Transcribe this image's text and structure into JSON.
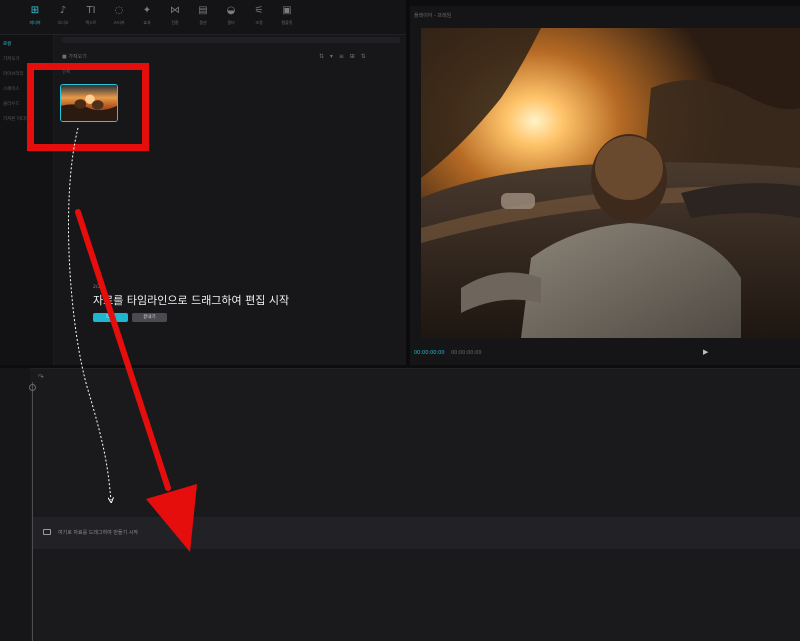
{
  "toolbar": {
    "tools": [
      {
        "icon": "media-icon",
        "glyph": "⊞",
        "label": "미디어",
        "active": true
      },
      {
        "icon": "audio-icon",
        "glyph": "♪",
        "label": "오디오",
        "active": false
      },
      {
        "icon": "text-icon",
        "glyph": "TI",
        "label": "텍스트",
        "active": false
      },
      {
        "icon": "sticker-icon",
        "glyph": "◌",
        "label": "스티커",
        "active": false
      },
      {
        "icon": "effects-icon",
        "glyph": "✦",
        "label": "효과",
        "active": false
      },
      {
        "icon": "transition-icon",
        "glyph": "⋈",
        "label": "전환",
        "active": false
      },
      {
        "icon": "caption-icon",
        "glyph": "▤",
        "label": "캡션",
        "active": false
      },
      {
        "icon": "filter-icon",
        "glyph": "◒",
        "label": "필터",
        "active": false
      },
      {
        "icon": "adjust-icon",
        "glyph": "⚟",
        "label": "조정",
        "active": false
      },
      {
        "icon": "template-icon",
        "glyph": "▣",
        "label": "템플릿",
        "active": false
      }
    ]
  },
  "leftnav": {
    "items": [
      {
        "label": "로컬",
        "active": true
      },
      {
        "label": "가져오기",
        "active": false
      },
      {
        "label": "라이브러리",
        "active": false
      },
      {
        "label": "스페이스",
        "active": false
      },
      {
        "label": "클라우드",
        "active": false
      },
      {
        "label": "가져온 미디어",
        "active": false
      }
    ]
  },
  "media": {
    "header": "■ 가져오기",
    "tools": "⇅ ▾  ≡  ⊞  ⇅",
    "count": "전체"
  },
  "hint": {
    "step": "2/3",
    "text": "자료를 타임라인으로 드래그하여 편집 시작",
    "primary_button": "다음",
    "secondary_button": "끝내기"
  },
  "player": {
    "title": "플레이어 - 프레임",
    "current_time": "00:00:00:00",
    "total_time": "00:00:00:00",
    "play_glyph": "▶"
  },
  "timeline": {
    "tools": "↶ ▾ ↷",
    "track_hint": "여기로 자료를 드래그하여 만들기 시작"
  },
  "annotation": {
    "color": "#e60d0d"
  }
}
